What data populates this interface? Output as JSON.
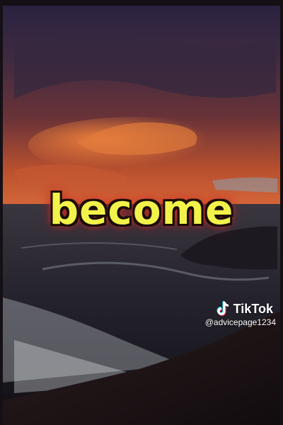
{
  "caption": {
    "text": "become",
    "color": "#f2f24a",
    "glow_color": "#e0322a"
  },
  "watermark": {
    "icon": "tiktok-logo-icon",
    "brand": "TikTok",
    "handle": "@advicepage1234"
  }
}
